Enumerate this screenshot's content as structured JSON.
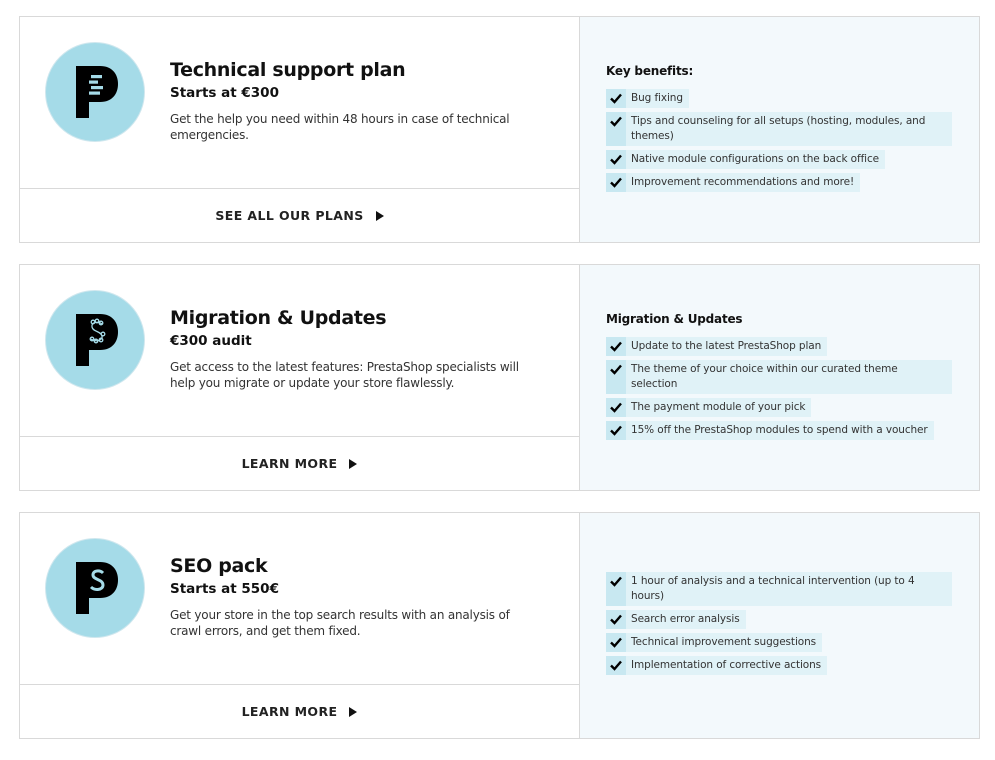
{
  "cards": [
    {
      "logo_icon": "prestashop-support-icon",
      "title": "Technical support plan",
      "price": "Starts at €300",
      "description": "Get the help you need within 48 hours in case of technical emergencies.",
      "cta_label": "SEE ALL OUR PLANS",
      "benefits_title": "Key benefits:",
      "benefits": [
        "Bug fixing",
        "Tips and counseling for all setups (hosting, modules, and themes)",
        "Native module configurations on the back office",
        "Improvement recommendations and more!"
      ]
    },
    {
      "logo_icon": "prestashop-migration-icon",
      "title": "Migration & Updates",
      "price": "€300 audit",
      "description": "Get access to the latest features: PrestaShop specialists will help you migrate or update your store flawlessly.",
      "cta_label": "LEARN MORE",
      "benefits_title": "Migration & Updates",
      "benefits": [
        "Update to the latest PrestaShop plan",
        "The theme of your choice within our curated theme selection",
        "The payment module of your pick",
        "15% off the PrestaShop modules to spend with a voucher"
      ]
    },
    {
      "logo_icon": "prestashop-seo-icon",
      "title": "SEO pack",
      "price": "Starts at 550€",
      "description": "Get your store in the top search results with an analysis of crawl errors, and get them fixed.",
      "cta_label": "LEARN MORE",
      "benefits_title": "",
      "benefits": [
        "1 hour of analysis and a technical intervention (up to 4 hours)",
        "Search error analysis",
        "Technical improvement suggestions",
        "Implementation of corrective actions"
      ]
    }
  ],
  "colors": {
    "logo_bg": "#a5dbe8",
    "panel_bg": "#f3f9fc",
    "benefit_bg": "#e0f2f7",
    "check_bg": "#c8e8f1",
    "border": "#d9d9d9"
  }
}
